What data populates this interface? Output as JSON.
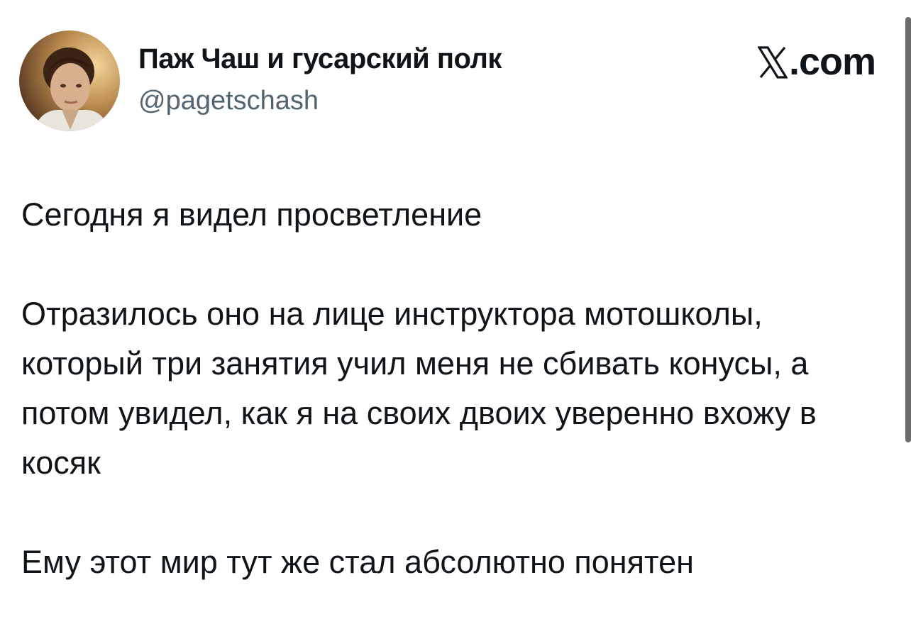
{
  "author": {
    "display_name": "Паж Чаш и гусарский полк",
    "handle": "@pagetschash",
    "avatar_icon": "user-avatar-photo"
  },
  "brand": {
    "icon": "x-logo-icon",
    "domain": ".com"
  },
  "tweet": {
    "paragraphs": [
      "Сегодня я видел просветление",
      "Отразилось оно на лице инструктора мотошколы, который три занятия учил меня не сбивать конусы, а потом увидел, как я на своих двоих уверенно вхожу в косяк",
      "Ему этот мир тут же стал абсолютно понятен"
    ]
  },
  "colors": {
    "text": "#0f1419",
    "secondary_text": "#536471",
    "background": "#ffffff"
  }
}
